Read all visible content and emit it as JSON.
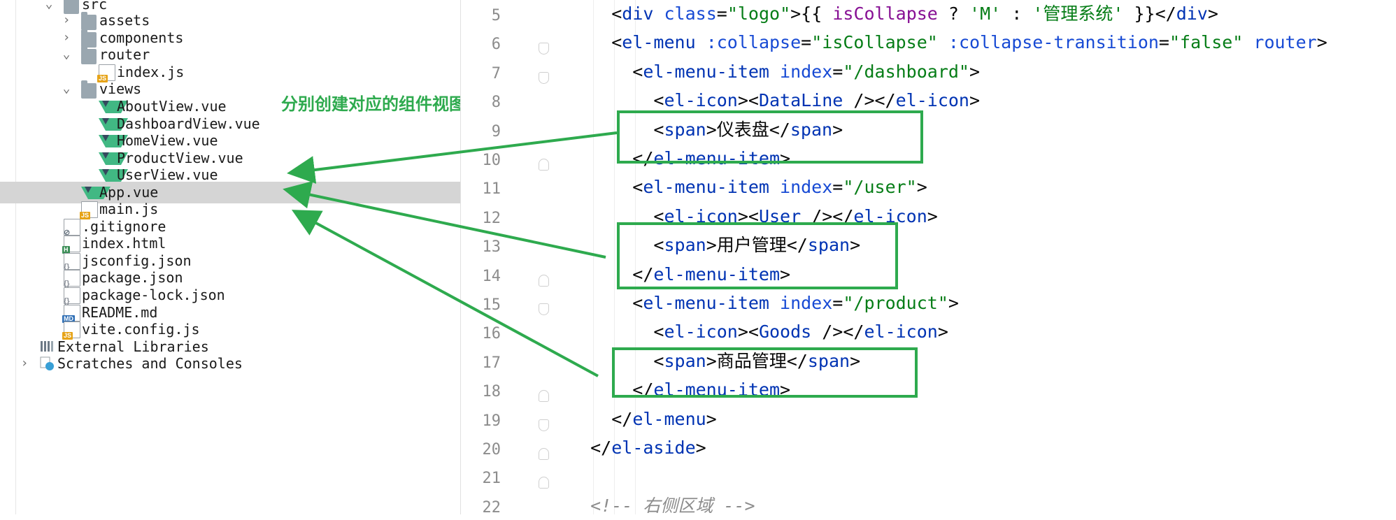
{
  "tree": {
    "items": [
      {
        "label": "src",
        "type": "folder",
        "expanded": true
      },
      {
        "label": "assets",
        "type": "folder",
        "expanded": false
      },
      {
        "label": "components",
        "type": "folder",
        "expanded": false
      },
      {
        "label": "router",
        "type": "folder",
        "expanded": true
      },
      {
        "label": "index.js",
        "type": "js"
      },
      {
        "label": "views",
        "type": "folder",
        "expanded": true
      },
      {
        "label": "AboutView.vue",
        "type": "vue"
      },
      {
        "label": "DashboardView.vue",
        "type": "vue"
      },
      {
        "label": "HomeView.vue",
        "type": "vue"
      },
      {
        "label": "ProductView.vue",
        "type": "vue"
      },
      {
        "label": "UserView.vue",
        "type": "vue"
      },
      {
        "label": "App.vue",
        "type": "vue",
        "selected": true
      },
      {
        "label": "main.js",
        "type": "js"
      },
      {
        "label": ".gitignore",
        "type": "ignore"
      },
      {
        "label": "index.html",
        "type": "html"
      },
      {
        "label": "jsconfig.json",
        "type": "json"
      },
      {
        "label": "package.json",
        "type": "json"
      },
      {
        "label": "package-lock.json",
        "type": "json"
      },
      {
        "label": "README.md",
        "type": "md"
      },
      {
        "label": "vite.config.js",
        "type": "js"
      },
      {
        "label": "External Libraries",
        "type": "libraries"
      },
      {
        "label": "Scratches and Consoles",
        "type": "scratches"
      }
    ]
  },
  "annotation": {
    "text": "分别创建对应的组件视图",
    "color": "#2eaa4e"
  },
  "editor": {
    "line_numbers": [
      "5",
      "6",
      "7",
      "8",
      "9",
      "10",
      "11",
      "12",
      "13",
      "14",
      "15",
      "16",
      "17",
      "18",
      "19",
      "20",
      "21",
      "22"
    ],
    "lines": [
      [
        {
          "c": "p",
          "t": "    <"
        },
        {
          "c": "t",
          "t": "div "
        },
        {
          "c": "a",
          "t": "class"
        },
        {
          "c": "p",
          "t": "="
        },
        {
          "c": "s",
          "t": "\"logo\""
        },
        {
          "c": "p",
          "t": ">{{ "
        },
        {
          "c": "v",
          "t": "isCollapse"
        },
        {
          "c": "p",
          "t": " ? "
        },
        {
          "c": "s",
          "t": "'M'"
        },
        {
          "c": "p",
          "t": " : "
        },
        {
          "c": "s",
          "t": "'管理系统'"
        },
        {
          "c": "p",
          "t": " }}</"
        },
        {
          "c": "t",
          "t": "div"
        },
        {
          "c": "p",
          "t": ">"
        }
      ],
      [
        {
          "c": "p",
          "t": "    <"
        },
        {
          "c": "t",
          "t": "el-menu "
        },
        {
          "c": "a",
          "t": ":collapse"
        },
        {
          "c": "p",
          "t": "="
        },
        {
          "c": "s",
          "t": "\"isCollapse\" "
        },
        {
          "c": "a",
          "t": ":collapse-transition"
        },
        {
          "c": "p",
          "t": "="
        },
        {
          "c": "s",
          "t": "\"false\" "
        },
        {
          "c": "a",
          "t": "router"
        },
        {
          "c": "p",
          "t": ">"
        }
      ],
      [
        {
          "c": "p",
          "t": "      <"
        },
        {
          "c": "t",
          "t": "el-menu-item "
        },
        {
          "c": "a",
          "t": "index"
        },
        {
          "c": "p",
          "t": "="
        },
        {
          "c": "s",
          "t": "\"/dashboard\""
        },
        {
          "c": "p",
          "t": ">"
        }
      ],
      [
        {
          "c": "p",
          "t": "        <"
        },
        {
          "c": "t",
          "t": "el-icon"
        },
        {
          "c": "p",
          "t": "><"
        },
        {
          "c": "t",
          "t": "DataLine "
        },
        {
          "c": "p",
          "t": "/></"
        },
        {
          "c": "t",
          "t": "el-icon"
        },
        {
          "c": "p",
          "t": ">"
        }
      ],
      [
        {
          "c": "p",
          "t": "        <"
        },
        {
          "c": "t",
          "t": "span"
        },
        {
          "c": "p",
          "t": ">仪表盘</"
        },
        {
          "c": "t",
          "t": "span"
        },
        {
          "c": "p",
          "t": ">"
        }
      ],
      [
        {
          "c": "p",
          "t": "      </"
        },
        {
          "c": "t",
          "t": "el-menu-item"
        },
        {
          "c": "p",
          "t": ">"
        }
      ],
      [
        {
          "c": "p",
          "t": "      <"
        },
        {
          "c": "t",
          "t": "el-menu-item "
        },
        {
          "c": "a",
          "t": "index"
        },
        {
          "c": "p",
          "t": "="
        },
        {
          "c": "s",
          "t": "\"/user\""
        },
        {
          "c": "p",
          "t": ">"
        }
      ],
      [
        {
          "c": "p",
          "t": "        <"
        },
        {
          "c": "t",
          "t": "el-icon"
        },
        {
          "c": "p",
          "t": "><"
        },
        {
          "c": "t",
          "t": "User "
        },
        {
          "c": "p",
          "t": "/></"
        },
        {
          "c": "t",
          "t": "el-icon"
        },
        {
          "c": "p",
          "t": ">"
        }
      ],
      [
        {
          "c": "p",
          "t": "        <"
        },
        {
          "c": "t",
          "t": "span"
        },
        {
          "c": "p",
          "t": ">用户管理</"
        },
        {
          "c": "t",
          "t": "span"
        },
        {
          "c": "p",
          "t": ">"
        }
      ],
      [
        {
          "c": "p",
          "t": "      </"
        },
        {
          "c": "t",
          "t": "el-menu-item"
        },
        {
          "c": "p",
          "t": ">"
        }
      ],
      [
        {
          "c": "p",
          "t": "      <"
        },
        {
          "c": "t",
          "t": "el-menu-item "
        },
        {
          "c": "a",
          "t": "index"
        },
        {
          "c": "p",
          "t": "="
        },
        {
          "c": "s",
          "t": "\"/product\""
        },
        {
          "c": "p",
          "t": ">"
        }
      ],
      [
        {
          "c": "p",
          "t": "        <"
        },
        {
          "c": "t",
          "t": "el-icon"
        },
        {
          "c": "p",
          "t": "><"
        },
        {
          "c": "t",
          "t": "Goods "
        },
        {
          "c": "p",
          "t": "/></"
        },
        {
          "c": "t",
          "t": "el-icon"
        },
        {
          "c": "p",
          "t": ">"
        }
      ],
      [
        {
          "c": "p",
          "t": "        <"
        },
        {
          "c": "t",
          "t": "span"
        },
        {
          "c": "p",
          "t": ">商品管理</"
        },
        {
          "c": "t",
          "t": "span"
        },
        {
          "c": "p",
          "t": ">"
        }
      ],
      [
        {
          "c": "p",
          "t": "      </"
        },
        {
          "c": "t",
          "t": "el-menu-item"
        },
        {
          "c": "p",
          "t": ">"
        }
      ],
      [
        {
          "c": "p",
          "t": "    </"
        },
        {
          "c": "t",
          "t": "el-menu"
        },
        {
          "c": "p",
          "t": ">"
        }
      ],
      [
        {
          "c": "p",
          "t": "  </"
        },
        {
          "c": "t",
          "t": "el-aside"
        },
        {
          "c": "p",
          "t": ">"
        }
      ],
      [],
      [
        {
          "c": "cm",
          "t": "  <!-- 右侧区域 -->"
        }
      ]
    ]
  },
  "colors": {
    "accent": "#2eaa4e",
    "tag": "#0033b3",
    "attribute": "#174ad4",
    "string": "#067d17",
    "variable": "#871094"
  }
}
